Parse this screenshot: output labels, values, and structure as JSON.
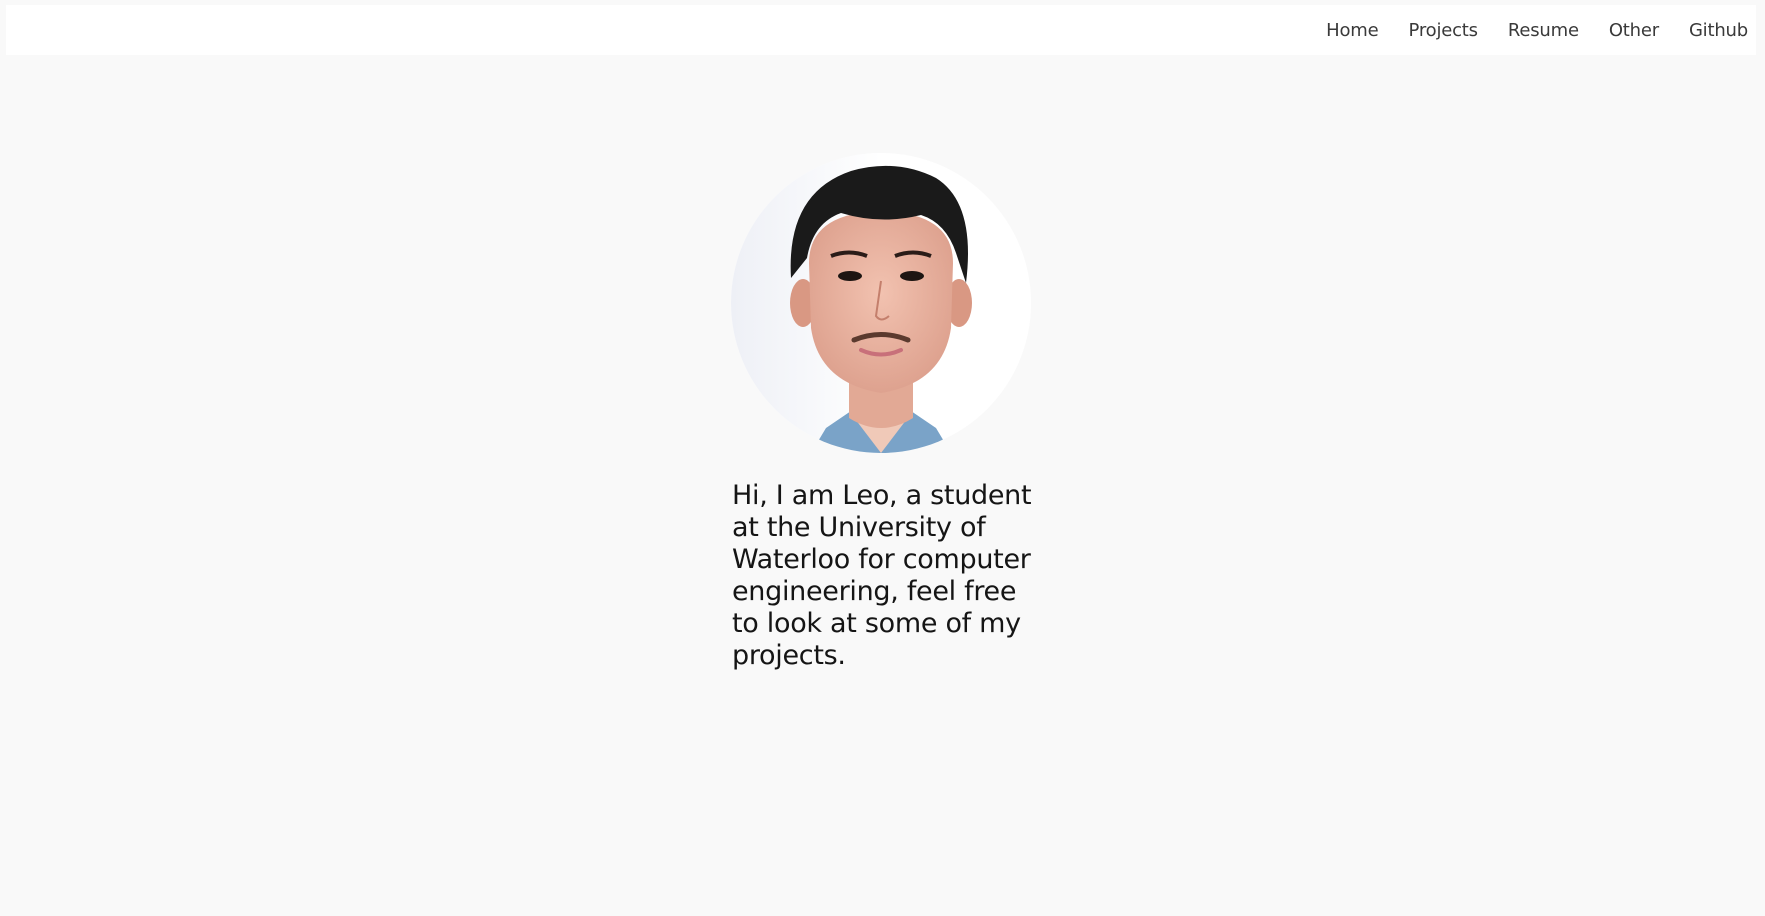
{
  "nav": {
    "items": [
      {
        "id": "home",
        "label": "Home"
      },
      {
        "id": "projects",
        "label": "Projects"
      },
      {
        "id": "resume",
        "label": "Resume"
      },
      {
        "id": "other",
        "label": "Other"
      },
      {
        "id": "github",
        "label": "Github"
      }
    ]
  },
  "profile": {
    "image_alt": "profile photo"
  },
  "intro": {
    "text": "Hi, I am Leo, a student at the University of Waterloo for computer engineering, feel free to look at some of my projects."
  },
  "colors": {
    "page_background": "#f9f9f9",
    "navbar_background": "#ffffff",
    "text": "#151515"
  }
}
